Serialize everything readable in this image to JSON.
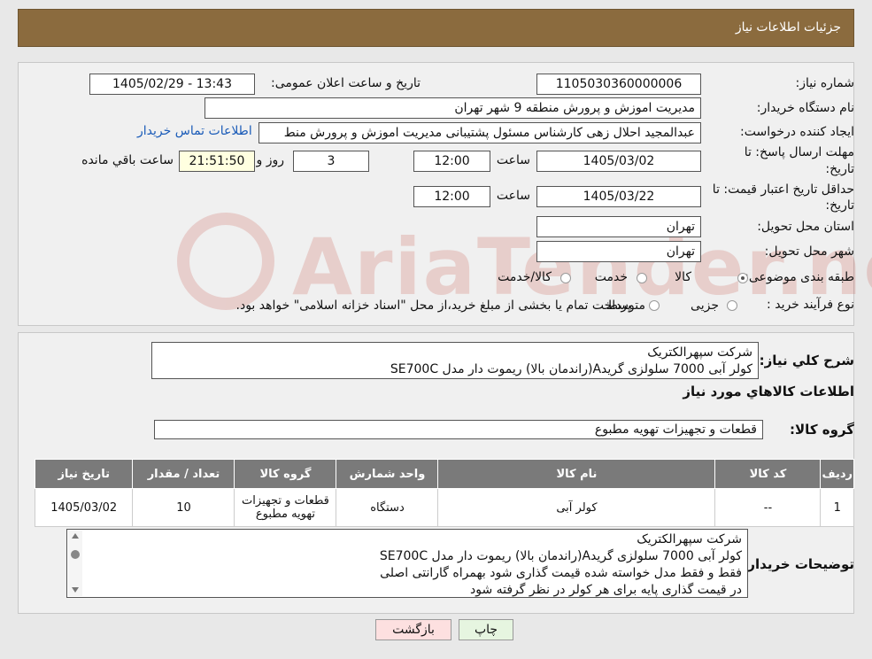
{
  "header": {
    "title": "جزئیات اطلاعات نیاز"
  },
  "watermark": "AriaTender.neT",
  "form": {
    "need_number_label": "شماره نیاز:",
    "need_number": "1105030360000006",
    "announce_label": "تاریخ و ساعت اعلان عمومی:",
    "announce_value": "1405/02/29 - 13:43",
    "buyer_org_label": "نام دستگاه خریدار:",
    "buyer_org": "مدیریت اموزش و پرورش منطقه 9 شهر تهران",
    "creator_label": "ایجاد کننده درخواست:",
    "creator": "عبدالمجید احلال زهی کارشناس مسئول پشتیبانی مدیریت اموزش و پرورش منط",
    "contact_link": "اطلاعات تماس خریدار",
    "deadline_label_1": "مهلت ارسال پاسخ: تا",
    "deadline_label_2": "تاریخ:",
    "deadline_date": "1405/03/02",
    "time_label": "ساعت",
    "deadline_time": "12:00",
    "days_value": "3",
    "days_label": "روز و",
    "remaining_time": "21:51:50",
    "remaining_label": "ساعت باقي مانده",
    "validity_label_1": "حداقل تاریخ اعتبار قیمت: تا",
    "validity_label_2": "تاریخ:",
    "validity_date": "1405/03/22",
    "validity_time": "12:00",
    "province_label": "استان محل تحویل:",
    "province": "تهران",
    "city_label": "شهر محل تحویل:",
    "city": "تهران",
    "category_label": "طبقه بندی موضوعی:",
    "category_options": [
      "کالا",
      "خدمت",
      "کالا/خدمت"
    ],
    "process_label": "نوع فرآیند خرید :",
    "process_options": [
      "جزیی",
      "متوسط"
    ],
    "process_note": "پرداخت تمام یا بخشی از مبلغ خرید،از محل \"اسناد خزانه اسلامی\" خواهد بود."
  },
  "summary": {
    "label": "شرح کلي نياز:",
    "line1": "شرکت سپهرالکتریک",
    "line2": "کولر آبی 7000 سلولزی گریدA(راندمان بالا) ریموت دار مدل  SE700C"
  },
  "goods_info_title": "اطلاعات کالاهاي مورد نياز",
  "goods_group_label": "گروه کالا:",
  "goods_group": "قطعات و تجهیزات تهویه مطبوع",
  "table": {
    "headers": [
      "رديف",
      "کد کالا",
      "نام کالا",
      "واحد شمارش",
      "گروه کالا",
      "تعداد / مقدار",
      "تاریخ نیاز"
    ],
    "row": [
      "1",
      "--",
      "کولر آبی",
      "دستگاه",
      "قطعات و تجهیزات تهویه مطبوع",
      "10",
      "1405/03/02"
    ]
  },
  "buyer_notes": {
    "label": "توضیحات خریدار:",
    "lines": [
      "شرکت سپهرالکتریک",
      "کولر آبی 7000 سلولزی گریدA(راندمان بالا) ریموت دار مدل SE700C",
      "فقط و فقط مدل خواسته شده قیمت گذاری شود بهمراه گارانتی اصلی",
      "در قیمت گذاری پایه برای هر کولر در نظر گرفته شود"
    ]
  },
  "buttons": {
    "print": "چاپ",
    "back": "بازگشت"
  },
  "colors": {
    "header": "#8b6b3e",
    "link": "#1a5bb8",
    "back_button": "#fde0e0",
    "print_button": "#e6f5e0"
  }
}
